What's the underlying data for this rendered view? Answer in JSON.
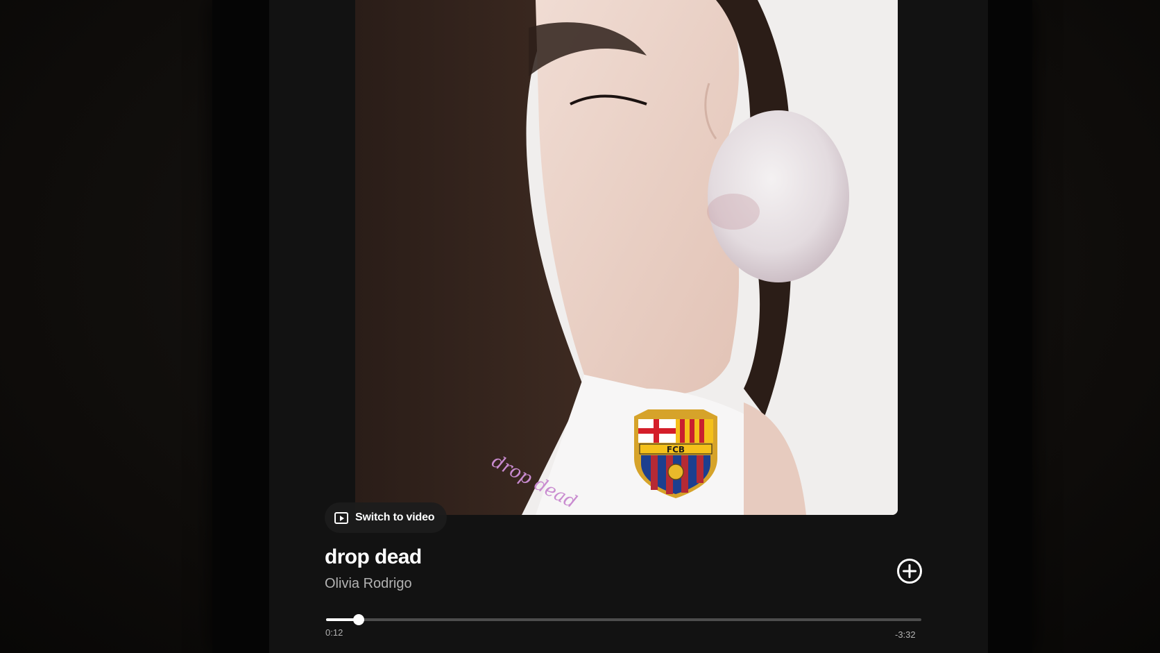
{
  "player": {
    "switch_to_video_label": "Switch to video",
    "track_title": "drop dead",
    "artist": "Olivia Rodrigo",
    "elapsed": "0:12",
    "remaining": "-3:32",
    "progress_fraction": 0.055,
    "artwork_shirt_text": "drop dead",
    "crest_text": "FCB"
  },
  "icons": {
    "video": "video-play-icon",
    "add": "add-circle-icon"
  },
  "colors": {
    "background": "#121212",
    "text_primary": "#ffffff",
    "text_secondary": "#b3b3b3",
    "progress_track": "#4d4d4d"
  }
}
